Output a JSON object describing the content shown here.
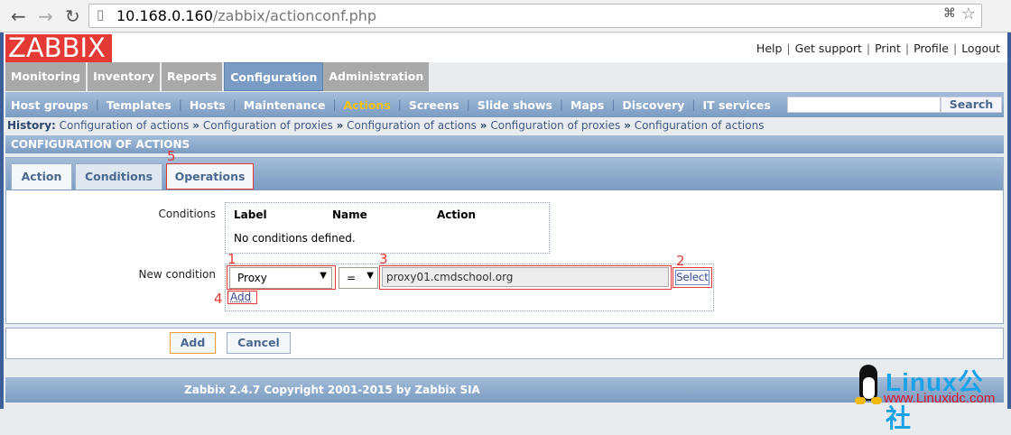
{
  "browser": {
    "url_domain": "10.168.0.160",
    "url_path": "/zabbix/actionconf.php"
  },
  "logo": "ZABBIX",
  "top_links": [
    "Help",
    "Get support",
    "Print",
    "Profile",
    "Logout"
  ],
  "main_menu": [
    {
      "label": "Monitoring"
    },
    {
      "label": "Inventory"
    },
    {
      "label": "Reports"
    },
    {
      "label": "Configuration",
      "active": true
    },
    {
      "label": "Administration"
    }
  ],
  "sub_menu": [
    "Host groups",
    "Templates",
    "Hosts",
    "Maintenance",
    "Actions",
    "Screens",
    "Slide shows",
    "Maps",
    "Discovery",
    "IT services"
  ],
  "search": {
    "button": "Search",
    "value": ""
  },
  "history": {
    "label": "History:",
    "items": [
      "Configuration of actions",
      "Configuration of proxies",
      "Configuration of actions",
      "Configuration of proxies",
      "Configuration of actions"
    ]
  },
  "section_title": "CONFIGURATION OF ACTIONS",
  "tabs": [
    "Action",
    "Conditions",
    "Operations"
  ],
  "conditions": {
    "label": "Conditions",
    "columns": [
      "Label",
      "Name",
      "Action"
    ],
    "empty": "No conditions defined."
  },
  "new_condition": {
    "label": "New condition",
    "type": "Proxy",
    "operator": "=",
    "value": "proxy01.cmdschool.org",
    "select": "Select",
    "add": "Add"
  },
  "annotations": [
    "1",
    "2",
    "3",
    "4",
    "5"
  ],
  "buttons": {
    "add": "Add",
    "cancel": "Cancel"
  },
  "footer": "Zabbix 2.4.7 Copyright 2001-2015 by Zabbix SIA",
  "watermark": {
    "brand": "Linux公社",
    "url": "www.Linuxidc.com"
  },
  "colors": {
    "accent": "#7b9cc2",
    "active_sub": "#f4c20d",
    "annotation": "#e53935",
    "logo": "#e53935"
  }
}
